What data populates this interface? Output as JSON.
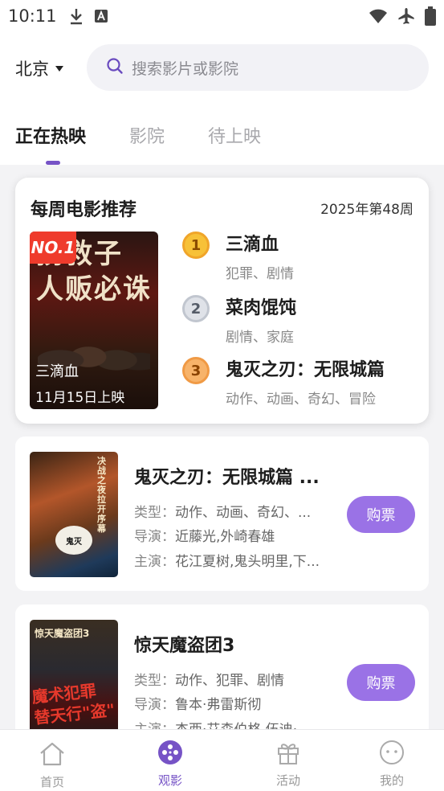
{
  "status_bar": {
    "time": "10:11",
    "left_icons": [
      "download-icon",
      "a-box-icon"
    ],
    "right_icons": [
      "wifi-icon",
      "airplane-icon",
      "battery-icon"
    ]
  },
  "header": {
    "city": "北京",
    "search_placeholder": "搜索影片或影院",
    "tabs": [
      "正在热映",
      "影院",
      "待上映"
    ],
    "active_tab": "正在热映"
  },
  "weekly": {
    "title": "每周电影推荐",
    "week": "2025年第48周",
    "main_poster": {
      "badge": "NO.1",
      "poster_text": "拐救子 人贩必诛",
      "title": "三滴血",
      "date": "11月15日上映"
    },
    "ranks": [
      {
        "num": "1",
        "name": "三滴血",
        "genre": "犯罪、剧情"
      },
      {
        "num": "2",
        "name": "菜肉馄饨",
        "genre": "剧情、家庭"
      },
      {
        "num": "3",
        "name": "鬼灭之刃：无限城篇",
        "genre": "动作、动画、奇幻、冒险"
      }
    ]
  },
  "movies": [
    {
      "title": "鬼灭之刃：无限城篇 ...",
      "type_label": "类型：",
      "type": "动作、动画、奇幻、...",
      "director_label": "导演：",
      "director": "近藤光,外崎春雄",
      "cast_label": "主演：",
      "cast": "花江夏树,鬼头明里,下...",
      "buy": "购票",
      "poster_side_text": "决战之夜拉开序幕"
    },
    {
      "title": "惊天魔盗团3",
      "type_label": "类型：",
      "type": "动作、犯罪、剧情",
      "director_label": "导演：",
      "director": "鲁本·弗雷斯彻",
      "cast_label": "主演：",
      "cast": "杰西·艾森伯格,伍迪·",
      "buy": "购票",
      "poster_top_text": "惊天魔盗团3",
      "poster_red_text": "魔术犯罪 替天行\"盗\""
    }
  ],
  "bottom_nav": [
    {
      "label": "首页",
      "icon": "home-icon"
    },
    {
      "label": "观影",
      "icon": "film-reel-icon"
    },
    {
      "label": "活动",
      "icon": "gift-icon"
    },
    {
      "label": "我的",
      "icon": "smiley-icon"
    }
  ],
  "colors": {
    "accent": "#7653c6",
    "buy_button": "#9a72e6",
    "badge_red": "#ef3b2c"
  }
}
